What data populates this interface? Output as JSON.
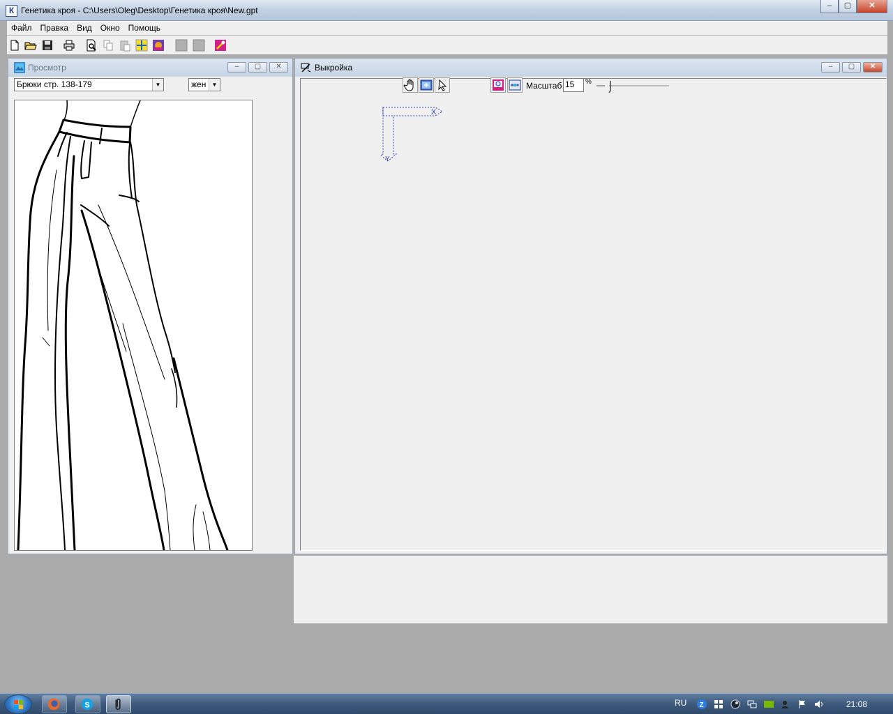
{
  "window": {
    "title": "Генетика кроя - C:\\Users\\Oleg\\Desktop\\Генетика кроя\\New.gpt",
    "app_icon_letter": "К"
  },
  "menu": [
    "Файл",
    "Правка",
    "Вид",
    "Окно",
    "Помощь"
  ],
  "toolbar_icons": [
    "new-document-icon",
    "open-folder-icon",
    "save-icon",
    "print-icon",
    "print-preview-icon",
    "copy-icon",
    "paste-icon",
    "insert-icon",
    "color-icon",
    "blank-icon",
    "blank-icon",
    "magic-wand-icon"
  ],
  "preview_window": {
    "title": "Просмотр",
    "model_select": "Брюки стр. 138-179",
    "gender_select": "жен"
  },
  "pattern_window": {
    "title": "Выкройка",
    "scale_label": "Масштаб",
    "scale_value": "15",
    "scale_unit": "%",
    "axis_x": "X",
    "axis_y": "Y"
  },
  "taskbar": {
    "language": "RU",
    "clock": "21:08",
    "pinned": [
      "firefox-icon",
      "skype-icon",
      "paperclip-icon"
    ]
  }
}
